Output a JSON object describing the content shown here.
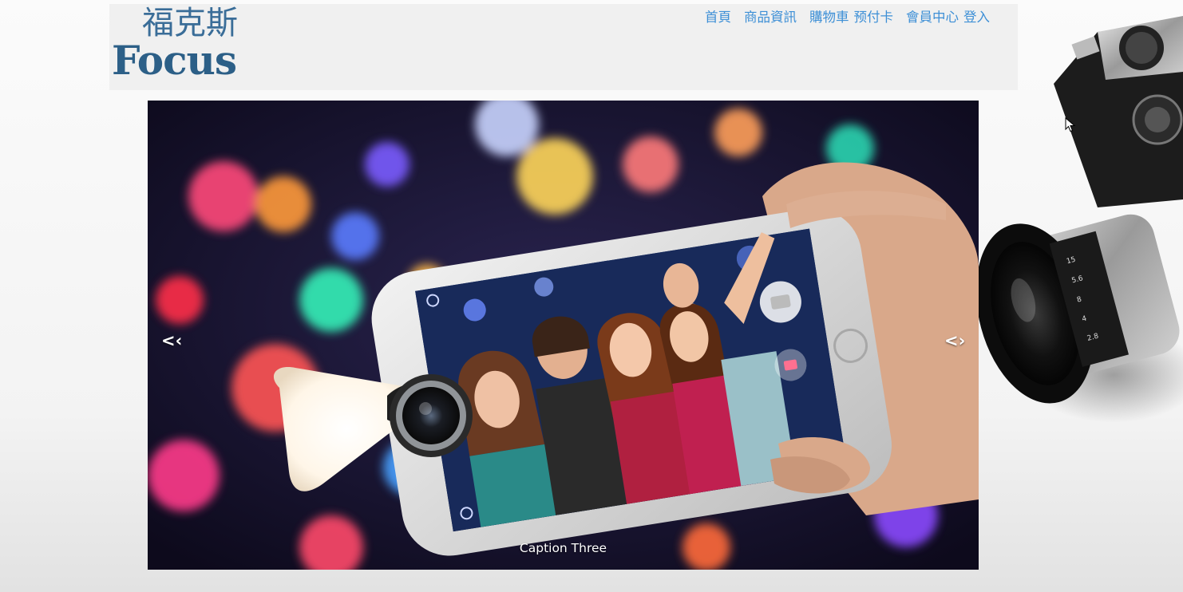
{
  "brand": {
    "name_cn": "福克斯",
    "name_en": "Focus"
  },
  "nav": {
    "home": "首頁",
    "products": "商品資訊",
    "cart": "購物車",
    "prepaid": "预付卡",
    "member": "會員中心",
    "login": "登入"
  },
  "carousel": {
    "prev_label": "<‹",
    "next_label": "<›",
    "caption": "Caption Three"
  },
  "colors": {
    "brand": "#2c5f87",
    "nav_link": "#3d8fd6",
    "header_bg": "#f0f0f0"
  },
  "icons": {
    "camera_decoration": "camera-icon",
    "mouse_cursor": "cursor-icon"
  }
}
